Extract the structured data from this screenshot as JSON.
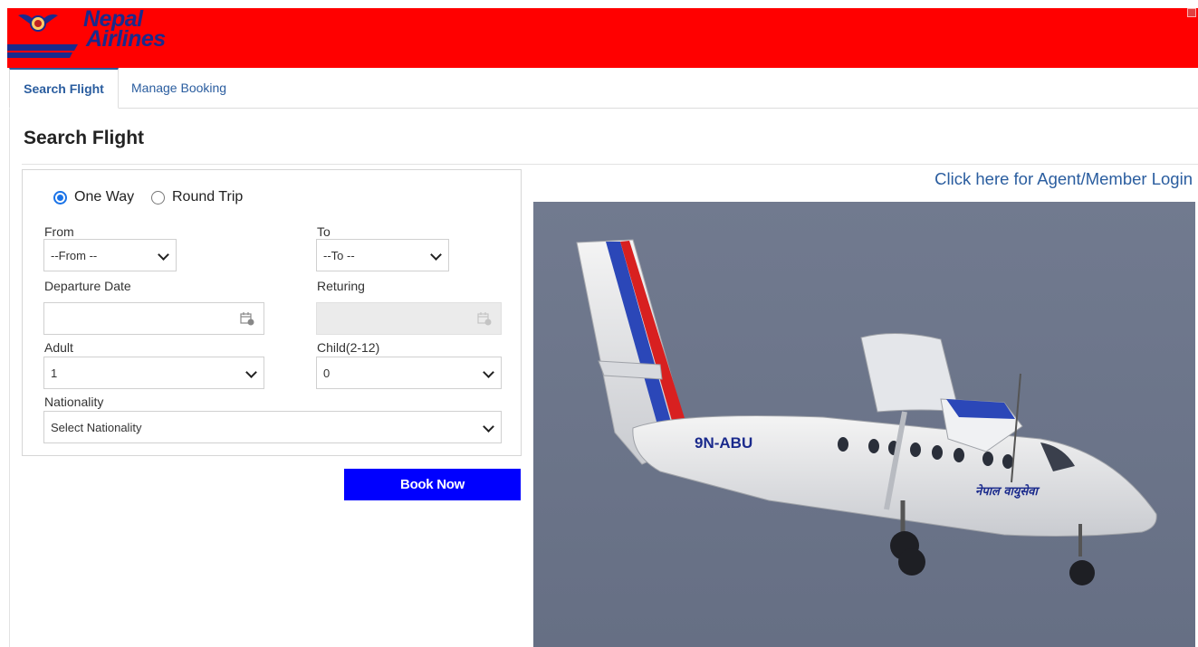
{
  "brand": {
    "line1": "Nepal",
    "line2": "Airlines"
  },
  "tabs": [
    {
      "label": "Search Flight",
      "active": true
    },
    {
      "label": "Manage Booking",
      "active": false
    }
  ],
  "page_title": "Search Flight",
  "form": {
    "trip_options": [
      {
        "label": "One Way",
        "selected": true
      },
      {
        "label": "Round Trip",
        "selected": false
      }
    ],
    "from": {
      "label": "From",
      "value": "--From --"
    },
    "to": {
      "label": "To",
      "value": "--To --"
    },
    "departure": {
      "label": "Departure Date",
      "value": ""
    },
    "returning": {
      "label": "Returing",
      "value": ""
    },
    "adult": {
      "label": "Adult",
      "value": "1"
    },
    "child": {
      "label": "Child(2-12)",
      "value": "0"
    },
    "nationality": {
      "label": "Nationality",
      "value": "Select Nationality"
    },
    "book_label": "Book Now"
  },
  "agent_login": "Click here for Agent/Member Login",
  "aircraft": {
    "registration": "9N-ABU",
    "livery_text": "नेपाल वायुसेवा"
  },
  "colors": {
    "header": "#ff0000",
    "brand_text": "#1a2a8c",
    "book_button": "#0000ff",
    "link": "#2a5d9f",
    "sky": "#6a7389"
  }
}
